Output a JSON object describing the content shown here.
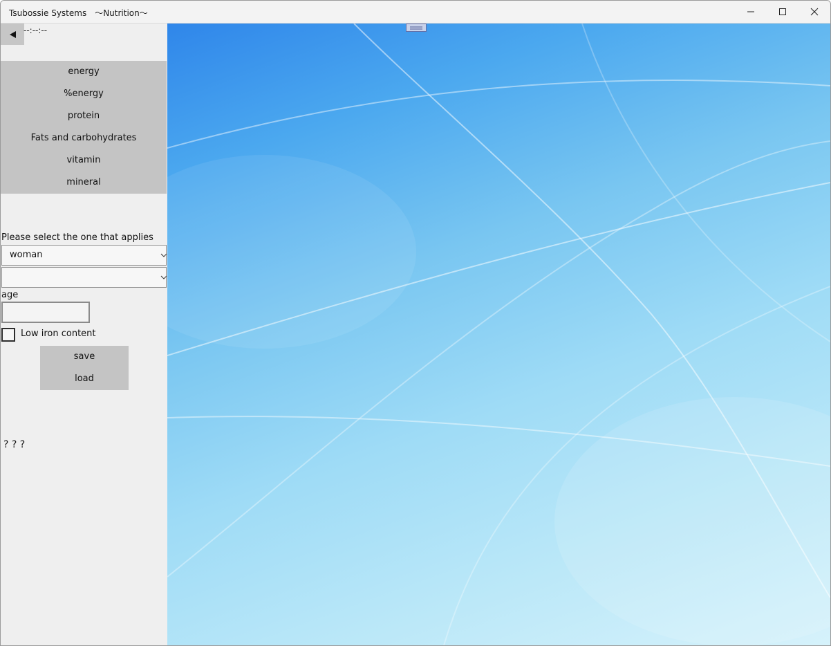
{
  "window": {
    "title": "Tsubossie Systems　〜Nutrition〜",
    "controls": {
      "minimize": "minimize-icon",
      "maximize": "maximize-icon",
      "close": "close-icon"
    }
  },
  "sidebar": {
    "back_icon": "left-triangle-icon",
    "time": "--:--:--",
    "menu": [
      "energy",
      "%energy",
      "protein",
      "Fats and carbohydrates",
      "vitamin",
      "mineral"
    ],
    "prompt": "Please select the one that applies",
    "select1": {
      "value": "woman"
    },
    "select2": {
      "value": ""
    },
    "age_label": "age",
    "age_value": "",
    "checkbox_label": "Low iron content",
    "checkbox_checked": false,
    "save_label": "save",
    "load_label": "load",
    "question_text": "? ? ?"
  },
  "colors": {
    "menu_bg": "#c4c4c4",
    "sidebar_bg": "#efefef",
    "content_gradient_start": "#2f86ea",
    "content_gradient_end": "#d6f2fb"
  }
}
